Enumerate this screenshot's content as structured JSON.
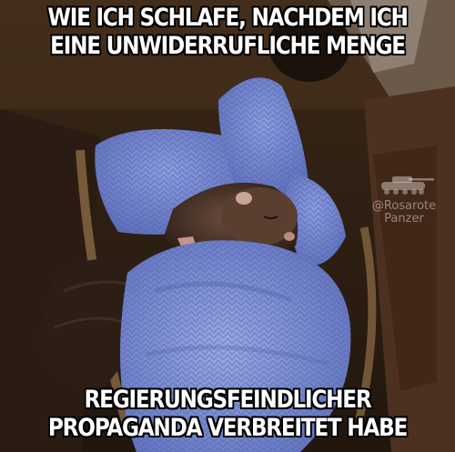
{
  "meme": {
    "top_text": [
      "WIE ICH SCHLAFE, NACHDEM ICH",
      "EINE UNWIDERRUFLICHE MENGE"
    ],
    "bottom_text": [
      "REGIERUNGSFEINDLICHER",
      "PROPAGANDA VERBREITET HABE"
    ],
    "watermark": {
      "line1": "@Rosarote",
      "line2": "Panzer",
      "icon": "tank-icon"
    }
  },
  "colors": {
    "caption_fill": "#ffffff",
    "caption_outline": "#000000",
    "blanket": "#7f92d6",
    "wood": "#5a3a22"
  }
}
